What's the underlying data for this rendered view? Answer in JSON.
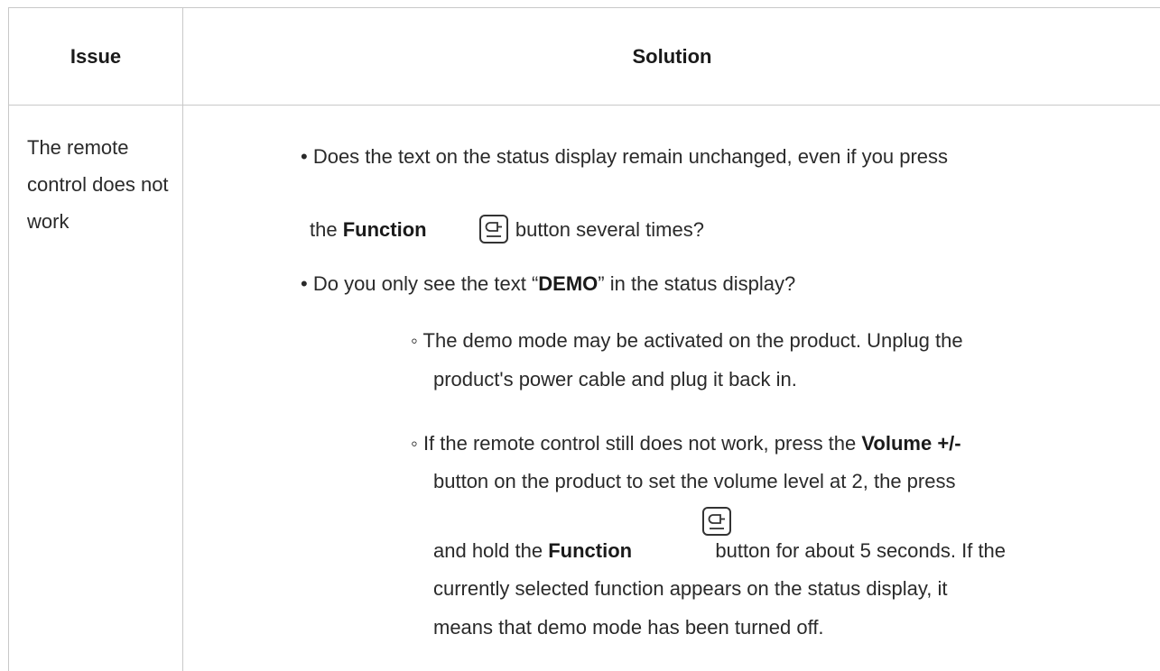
{
  "table": {
    "headers": {
      "issue": "Issue",
      "solution": "Solution"
    },
    "row": {
      "issue": "The remote control does not work",
      "bullet1": {
        "marker": "•",
        "line1": "Does the text on the status display remain unchanged, even if you press",
        "line2_pre": "the",
        "line2_bold": "Function",
        "line2_post": "button several times?"
      },
      "bullet2": {
        "marker": "•",
        "pre": "Do you only see the text “",
        "bold": "DEMO",
        "post": "” in the status display?"
      },
      "sub1": {
        "marker": "◦",
        "line1": "The demo mode may be activated on the product. Unplug the",
        "line2": "product's power cable and plug it back in."
      },
      "sub2": {
        "marker": "◦",
        "line1_pre": "If the remote control still does not work, press the",
        "line1_bold": "Volume +/-",
        "line2": "button on the product to set the volume level at 2, the press",
        "line3_pre": "and hold the",
        "line3_bold": "Function",
        "line3_post": "button for about 5 seconds. If the",
        "line4": "currently selected function appears on the status display, it",
        "line5": "means that demo mode has been turned off."
      }
    }
  },
  "icons": {
    "function_button": "function-button-icon"
  }
}
